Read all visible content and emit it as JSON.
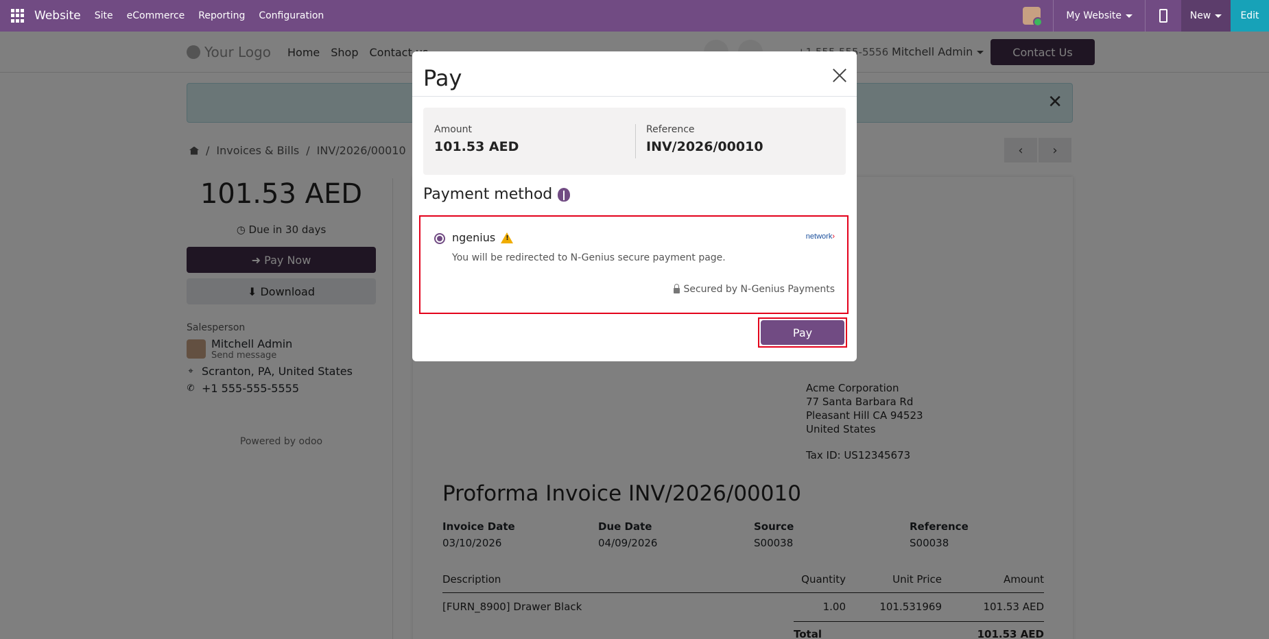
{
  "topbar": {
    "app_name": "Website",
    "menus": [
      "Site",
      "eCommerce",
      "Reporting",
      "Configuration"
    ],
    "my_website": "My Website",
    "new_label": "New",
    "edit_label": "Edit"
  },
  "header": {
    "logo_text": "Your Logo",
    "nav": [
      "Home",
      "Shop",
      "Contact us"
    ],
    "phone": "+1 555-555-5556",
    "user": "Mitchell Admin",
    "contact_button": "Contact Us"
  },
  "breadcrumb": {
    "items": [
      "Invoices & Bills",
      "INV/2026/00010"
    ],
    "separator": "/"
  },
  "sidebar": {
    "amount": "101.53 AED",
    "due": "Due in 30 days",
    "pay_now": "Pay Now",
    "download": "Download",
    "salesperson_label": "Salesperson",
    "salesperson_name": "Mitchell Admin",
    "send_message": "Send message",
    "location": "Scranton, PA, United States",
    "phone": "+1 555-555-5555",
    "powered_by": "Powered by",
    "powered_brand": "odoo"
  },
  "document": {
    "address": [
      "Acme Corporation",
      "77 Santa Barbara Rd",
      "Pleasant Hill CA 94523",
      "United States"
    ],
    "tax_id": "Tax ID: US12345673",
    "title": "Proforma Invoice INV/2026/00010",
    "meta": [
      {
        "label": "Invoice Date",
        "value": "03/10/2026"
      },
      {
        "label": "Due Date",
        "value": "04/09/2026"
      },
      {
        "label": "Source",
        "value": "S00038"
      },
      {
        "label": "Reference",
        "value": "S00038"
      }
    ],
    "columns": [
      "Description",
      "Quantity",
      "Unit Price",
      "Amount"
    ],
    "row": {
      "description": "[FURN_8900] Drawer Black",
      "quantity": "1.00",
      "unit_price": "101.531969",
      "amount": "101.53 AED"
    },
    "total_label": "Total",
    "total_value": "101.53 AED"
  },
  "modal": {
    "title": "Pay",
    "amount_label": "Amount",
    "amount_value": "101.53 AED",
    "reference_label": "Reference",
    "reference_value": "INV/2026/00010",
    "payment_method_title": "Payment method",
    "provider_name": "ngenius",
    "provider_logo": "network",
    "provider_desc": "You will be redirected to N-Genius secure payment page.",
    "secured_by": "Secured by N-Genius Payments",
    "pay_button": "Pay"
  },
  "colors": {
    "brand": "#714b83",
    "dark_brand": "#3e2a47",
    "edit": "#17a2b8",
    "highlight": "#e3001b"
  }
}
